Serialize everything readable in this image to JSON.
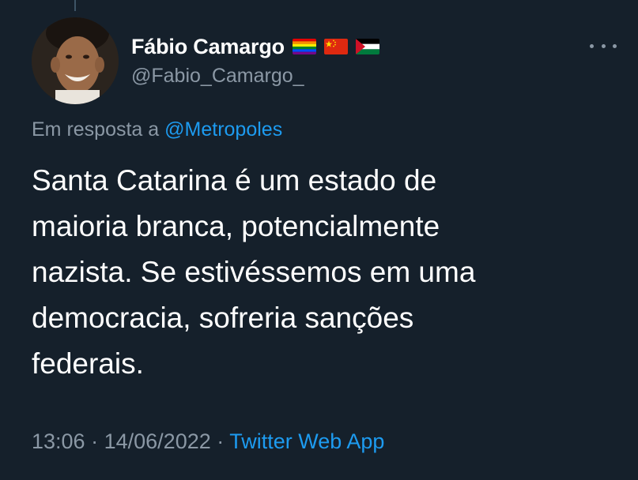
{
  "tweet": {
    "author": {
      "display_name": "Fábio Camargo",
      "handle": "@Fabio_Camargo_",
      "flags": [
        "rainbow-flag-icon",
        "china-flag-icon",
        "palestine-flag-icon"
      ]
    },
    "reply": {
      "prefix": "Em resposta a",
      "mention": "@Metropoles"
    },
    "lines": [
      "Santa Catarina é um estado de",
      "maioria branca, potencialmente",
      "nazista. Se estivéssemos em uma",
      "democracia, sofreria sanções",
      "federais."
    ],
    "meta": {
      "time": "13:06",
      "date": "14/06/2022",
      "separator": "·",
      "source": "Twitter Web App"
    }
  },
  "colors": {
    "background": "#15202b",
    "primary_text": "#ffffff",
    "secondary_text": "#8b98a5",
    "link": "#1d9bf0"
  }
}
